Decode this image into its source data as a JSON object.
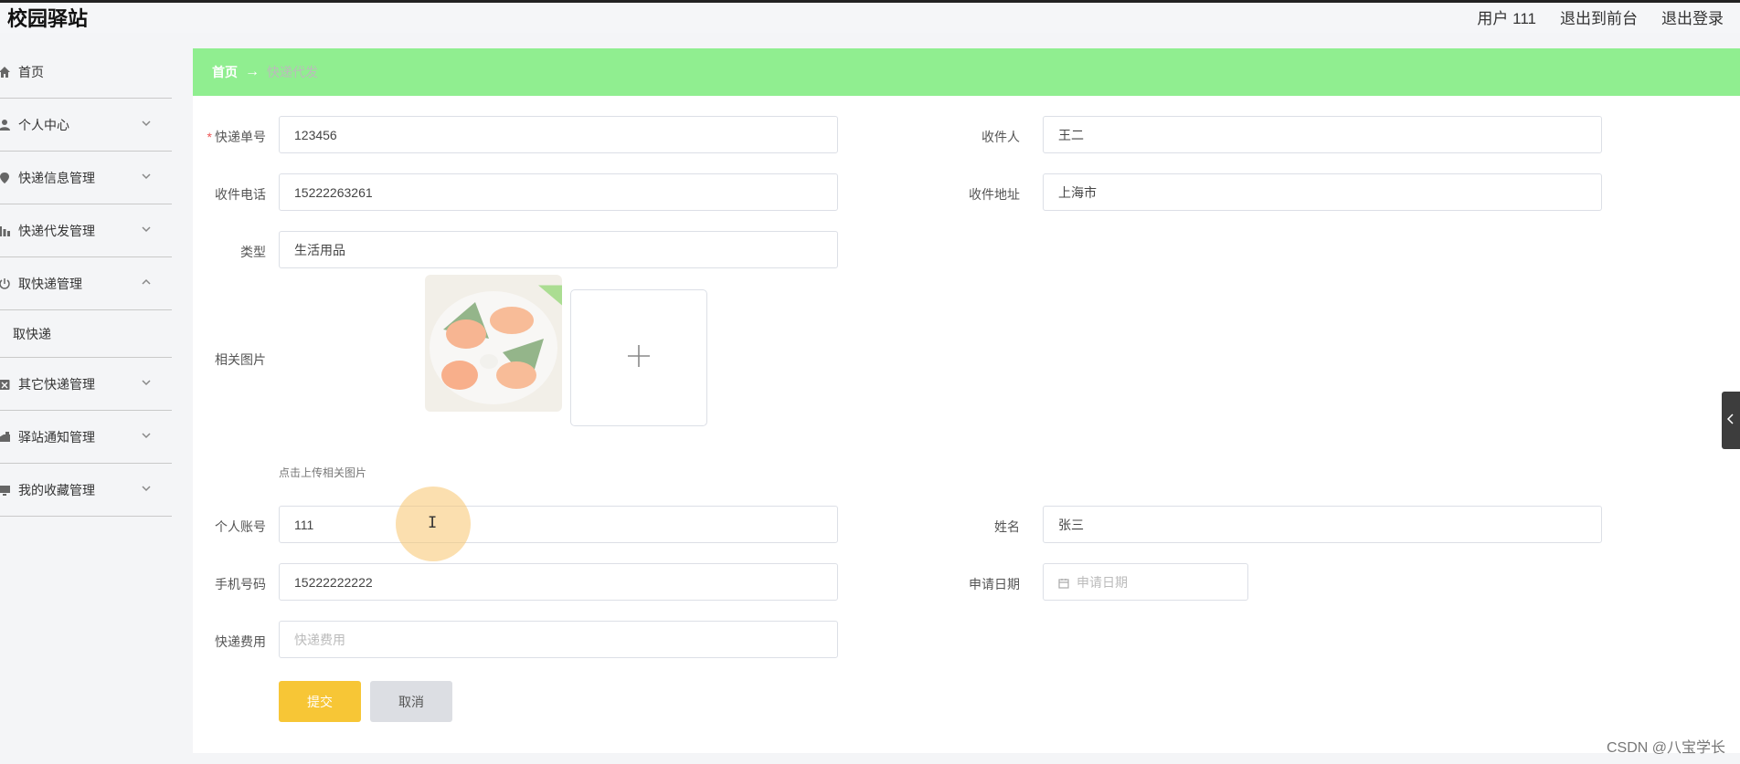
{
  "header": {
    "logo": "校园驿站",
    "user": "用户 111",
    "back_front": "退出到前台",
    "logout": "退出登录"
  },
  "sidebar": {
    "items": [
      {
        "label": "首页",
        "icon": "home-icon"
      },
      {
        "label": "个人中心",
        "icon": "user-icon"
      },
      {
        "label": "快递信息管理",
        "icon": "location-icon"
      },
      {
        "label": "快递代发管理",
        "icon": "chart-icon"
      },
      {
        "label": "取快递管理",
        "icon": "power-icon"
      },
      {
        "label": "其它快递管理",
        "icon": "box-icon"
      },
      {
        "label": "驿站通知管理",
        "icon": "bell-icon"
      },
      {
        "label": "我的收藏管理",
        "icon": "monitor-icon"
      }
    ],
    "sub_item": "取快递"
  },
  "breadcrumb": {
    "home": "首页",
    "arrow": "→",
    "current": "快递代发"
  },
  "form": {
    "tracking_no_label": "快递单号",
    "tracking_no_required": "*",
    "tracking_no": "123456",
    "recipient_label": "收件人",
    "recipient": "王二",
    "phone_label": "收件电话",
    "phone": "15222263261",
    "address_label": "收件地址",
    "address": "上海市",
    "type_label": "类型",
    "type": "生活用品",
    "image_label": "相关图片",
    "image_tip": "点击上传相关图片",
    "account_label": "个人账号",
    "account": "111",
    "name_label": "姓名",
    "name": "张三",
    "mobile_label": "手机号码",
    "mobile": "15222222222",
    "apply_date_label": "申请日期",
    "apply_date_placeholder": "申请日期",
    "fee_label": "快递费用",
    "fee_placeholder": "快递费用",
    "submit": "提交",
    "cancel": "取消"
  },
  "watermark": "CSDN @八宝学长"
}
